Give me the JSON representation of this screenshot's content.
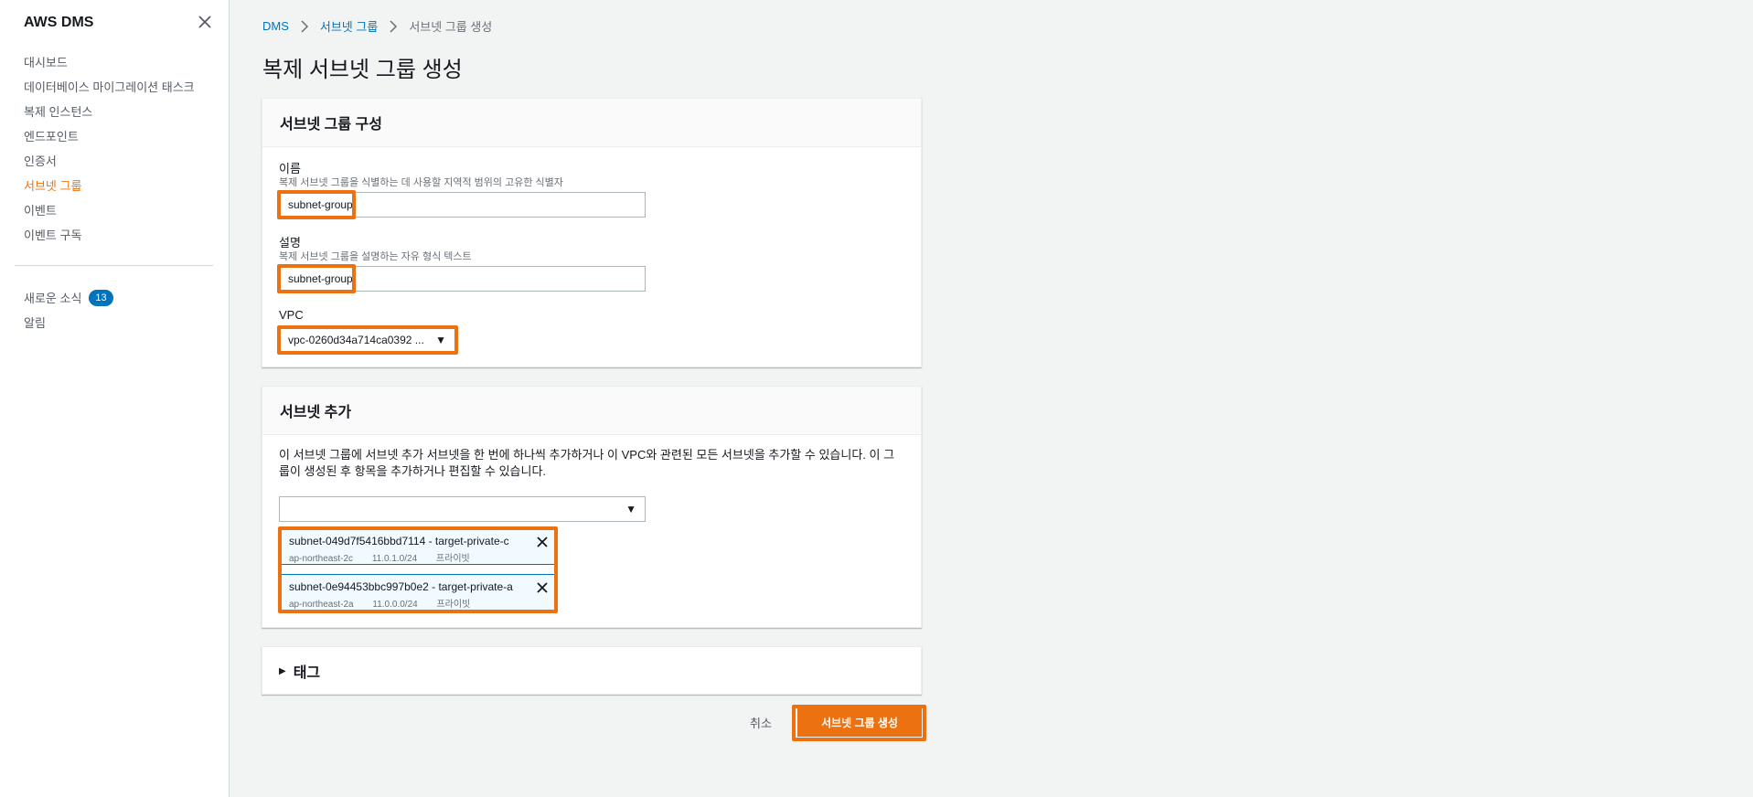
{
  "sidebar": {
    "title": "AWS DMS",
    "items": [
      {
        "label": "대시보드"
      },
      {
        "label": "데이터베이스 마이그레이션 태스크"
      },
      {
        "label": "복제 인스턴스"
      },
      {
        "label": "엔드포인트"
      },
      {
        "label": "인증서"
      },
      {
        "label": "서브넷 그룹"
      },
      {
        "label": "이벤트"
      },
      {
        "label": "이벤트 구독"
      }
    ],
    "news_label": "새로운 소식",
    "news_count": "13",
    "alerts_label": "알림"
  },
  "breadcrumb": {
    "root": "DMS",
    "parent": "서브넷 그룹",
    "current": "서브넷 그룹 생성"
  },
  "page": {
    "title": "복제 서브넷 그룹 생성"
  },
  "config": {
    "heading": "서브넷 그룹 구성",
    "name_label": "이름",
    "name_desc": "복제 서브넷 그룹을 식별하는 데 사용할 지역적 범위의 고유한 식별자",
    "name_value": "subnet-group",
    "desc_label": "설명",
    "desc_desc": "복제 서브넷 그룹을 설명하는 자유 형식 텍스트",
    "desc_value": "subnet-group",
    "vpc_label": "VPC",
    "vpc_value": "vpc-0260d34a714ca0392 ..."
  },
  "subnets": {
    "heading": "서브넷 추가",
    "description": "이 서브넷 그룹에 서브넷 추가 서브넷을 한 번에 하나씩 추가하거나 이 VPC와 관련된 모든 서브넷을 추가할 수 있습니다. 이 그룹이 생성된 후 항목을 추가하거나 편집할 수 있습니다.",
    "selected": [
      {
        "name": "subnet-049d7f5416bbd7114 - target-private-c",
        "az": "ap-northeast-2c",
        "cidr": "11.0.1.0/24",
        "type": "프라이빗"
      },
      {
        "name": "subnet-0e94453bbc997b0e2 - target-private-a",
        "az": "ap-northeast-2a",
        "cidr": "11.0.0.0/24",
        "type": "프라이빗"
      }
    ]
  },
  "tags": {
    "heading": "태그"
  },
  "actions": {
    "cancel": "취소",
    "create": "서브넷 그룹 생성"
  },
  "colors": {
    "accent": "#ec7211",
    "link": "#0073bb"
  }
}
